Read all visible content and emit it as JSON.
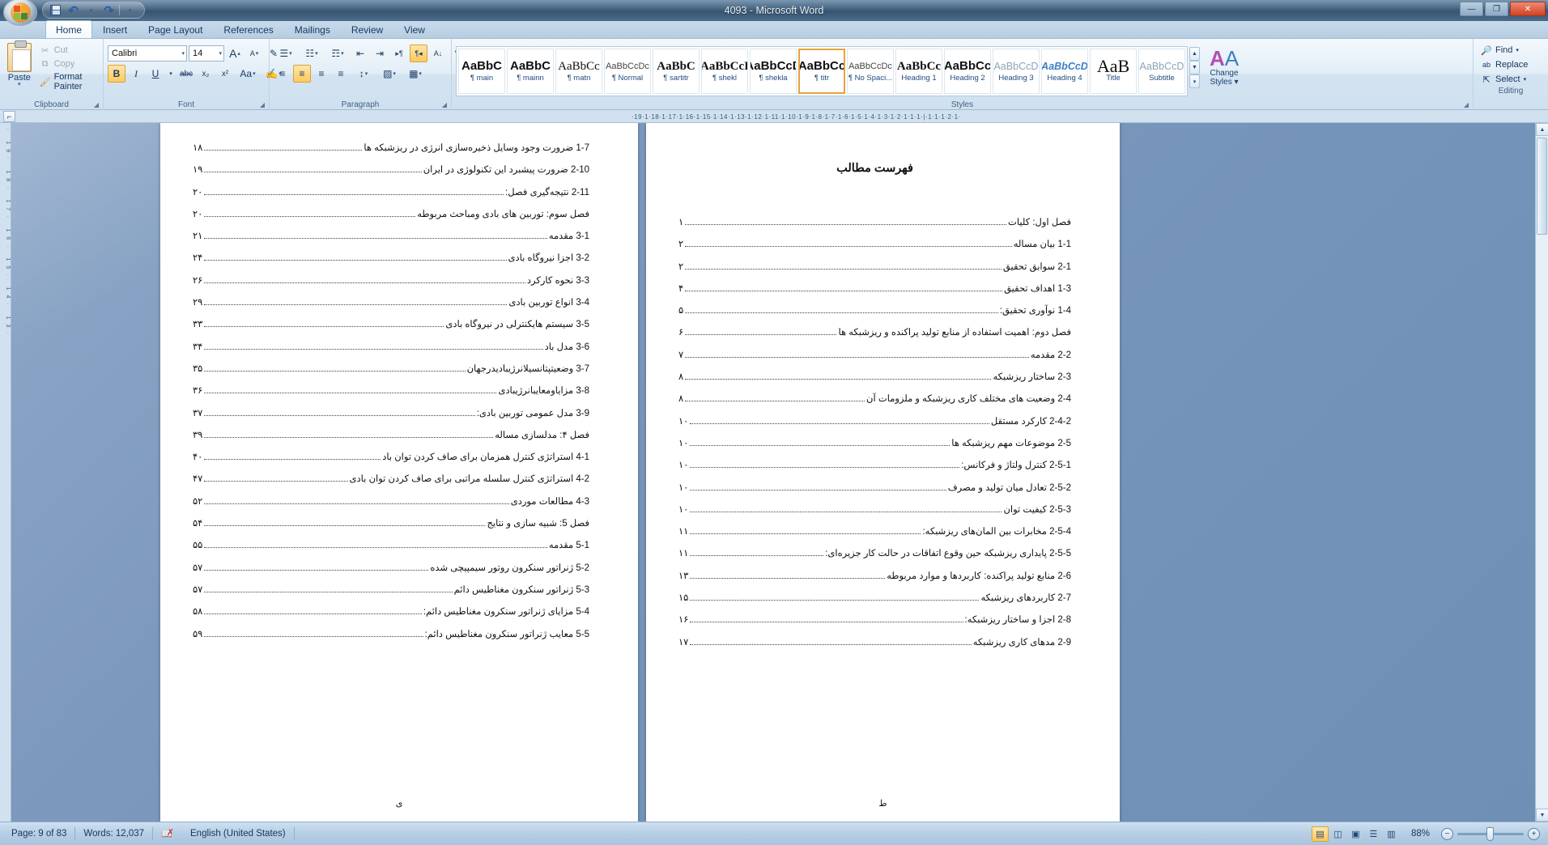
{
  "window": {
    "title": "4093 - Microsoft Word",
    "minimize": "—",
    "maximize": "❐",
    "close": "✕"
  },
  "quick_access": {
    "save": "save-icon",
    "undo": "↶",
    "undo_caret": "▾",
    "redo": "↷",
    "customize_caret": "▾"
  },
  "tabs": [
    {
      "label": "Home",
      "active": true
    },
    {
      "label": "Insert",
      "active": false
    },
    {
      "label": "Page Layout",
      "active": false
    },
    {
      "label": "References",
      "active": false
    },
    {
      "label": "Mailings",
      "active": false
    },
    {
      "label": "Review",
      "active": false
    },
    {
      "label": "View",
      "active": false
    }
  ],
  "ribbon": {
    "clipboard": {
      "label": "Clipboard",
      "paste": "Paste",
      "paste_caret": "▾",
      "cut": "Cut",
      "copy": "Copy",
      "format_painter": "Format Painter",
      "launcher": "◢"
    },
    "font": {
      "label": "Font",
      "font_name": "Calibri",
      "font_size": "14",
      "grow": "A",
      "shrink": "A",
      "clear_formatting": "✎",
      "bold": "B",
      "italic": "I",
      "underline": "U",
      "underline_caret": "▾",
      "strikethrough": "abc",
      "subscript": "x₂",
      "superscript": "x²",
      "change_case": "Aa",
      "change_case_caret": "▾",
      "highlight": "✍",
      "highlight_caret": "▾",
      "font_color": "A",
      "font_color_caret": "▾",
      "launcher": "◢"
    },
    "paragraph": {
      "label": "Paragraph",
      "bullets": "☰",
      "bullets_caret": "▾",
      "numbering": "☷",
      "numbering_caret": "▾",
      "multilevel": "☶",
      "multilevel_caret": "▾",
      "decrease_indent": "⇤",
      "increase_indent": "⇥",
      "ltr": "▸¶",
      "rtl": "¶◂",
      "sort": "A↓",
      "show_marks": "¶",
      "align_left": "≡",
      "align_center": "≡",
      "align_right": "≡",
      "justify": "≡",
      "line_spacing": "↕",
      "line_spacing_caret": "▾",
      "shading": "▨",
      "shading_caret": "▾",
      "borders": "▦",
      "borders_caret": "▾",
      "launcher": "◢"
    },
    "styles": {
      "label": "Styles",
      "items": [
        {
          "preview": "AaBbC",
          "name": "¶ main",
          "selected": false,
          "style": "bold-sans"
        },
        {
          "preview": "AaBbC",
          "name": "¶ mainn",
          "selected": false,
          "style": "bold-sans"
        },
        {
          "preview": "AaBbCс",
          "name": "¶ matn",
          "selected": false,
          "style": "serif"
        },
        {
          "preview": "AaBbCcDc",
          "name": "¶ Normal",
          "selected": false,
          "style": "small-sans"
        },
        {
          "preview": "AaBbC",
          "name": "¶ sartitr",
          "selected": false,
          "style": "bold-serif"
        },
        {
          "preview": "AaBbCcI",
          "name": "¶ shekl",
          "selected": false,
          "style": "bold-serif"
        },
        {
          "preview": "AaBbCcD",
          "name": "¶ shekla",
          "selected": false,
          "style": "bold-sans"
        },
        {
          "preview": "AaBbCc",
          "name": "¶ titr",
          "selected": true,
          "style": "bold-sans"
        },
        {
          "preview": "AaBbCcDc",
          "name": "¶ No Spaci...",
          "selected": false,
          "style": "small-sans"
        },
        {
          "preview": "AaBbCc",
          "name": "Heading 1",
          "selected": false,
          "style": "bold-serif"
        },
        {
          "preview": "AaBbCc",
          "name": "Heading 2",
          "selected": false,
          "style": "bold-sans"
        },
        {
          "preview": "AaBbCcD",
          "name": "Heading 3",
          "selected": false,
          "style": "light-sans"
        },
        {
          "preview": "AaBbCcD",
          "name": "Heading 4",
          "selected": false,
          "style": "italic-blue"
        },
        {
          "preview": "AaB",
          "name": "Title",
          "selected": false,
          "style": "big-serif"
        },
        {
          "preview": "AaBbCcD",
          "name": "Subtitle",
          "selected": false,
          "style": "light-sans"
        }
      ],
      "nav_up": "▲",
      "nav_down": "▼",
      "nav_more": "▾",
      "change_styles": "Change",
      "change_styles2": "Styles",
      "change_styles_caret": "▾",
      "launcher": "◢"
    },
    "editing": {
      "label": "Editing",
      "find": "Find",
      "find_caret": "▾",
      "replace": "Replace",
      "select": "Select",
      "select_caret": "▾"
    }
  },
  "ruler": {
    "tab_selector": "⌐",
    "marks": "·19·1·18·1·17·1·16·1·15·1·14·1·13·1·12·1·11·1·10·1·9·1·8·1·7·1·6·1·5·1·4·1·3·1·2·1·1·1·|·1·1·1·2·1·"
  },
  "document": {
    "left_page": {
      "footer": "ی",
      "entries": [
        {
          "text": "1-7 ضرورت وجود وسایل ذخیره‌سازی انرژی در ریزشبکه ها",
          "page": "۱۸"
        },
        {
          "text": "2-10 ضرورت پیشبرد این تکنولوژی در ایران",
          "page": "۱۹"
        },
        {
          "text": "2-11 نتیجه‌گیری فصل:",
          "page": "۲۰"
        },
        {
          "text": "فصل سوم: توربین های بادی ومباحث مربوطه",
          "page": "۲۰"
        },
        {
          "text": "3-1 مقدمه",
          "page": "۲۱"
        },
        {
          "text": "3-2 اجزا نیروگاه بادی",
          "page": "۲۴"
        },
        {
          "text": "3-3  نحوه کارکرد",
          "page": "۲۶"
        },
        {
          "text": "3-4 انواع توربین بادی",
          "page": "۲۹"
        },
        {
          "text": "3-5 سیستم هایکنترلی در نیروگاه بادی",
          "page": "۳۳"
        },
        {
          "text": "3-6 مدل باد",
          "page": "۳۴"
        },
        {
          "text": "3-7 وضعیتپتانسیلانرژیبادیدرجهان",
          "page": "۳۵"
        },
        {
          "text": "3-8 مزایاومعایبانرژیبادی",
          "page": "۳۶"
        },
        {
          "text": "3-9 مدل عمومی توربین بادی:",
          "page": "۳۷"
        },
        {
          "text": "فصل ۴: مدلسازی مساله",
          "page": "۳۹"
        },
        {
          "text": "4-1 استراتژی کنترل همزمان برای صاف کردن توان باد",
          "page": "۴۰"
        },
        {
          "text": "4-2 استراتژی کنترل سلسله مراتبی برای صاف کردن توان بادی",
          "page": "۴۷"
        },
        {
          "text": "4-3 مطالعات موردی",
          "page": "۵۲"
        },
        {
          "text": "فصل 5: شبیه سازی و نتایج",
          "page": "۵۴"
        },
        {
          "text": "5-1 مقدمه",
          "page": "۵۵"
        },
        {
          "text": "5-2 ژنراتور سنکرون روتور سیمپیچی شده",
          "page": "۵۷"
        },
        {
          "text": "5-3 ژنراتور سنکرون مغناطیس دائم",
          "page": "۵۷"
        },
        {
          "text": "5-4 مزایای ژنراتور سنکرون مغناطیس دائم:",
          "page": "۵۸"
        },
        {
          "text": "5-5 معایب ژنراتور سنکرون مغناطیس دائم:",
          "page": "۵۹"
        }
      ]
    },
    "right_page": {
      "title": "فهرست مطالب",
      "footer": "ط",
      "entries": [
        {
          "text": "فصل اول: کلیات",
          "page": "۱"
        },
        {
          "text": "1-1 بیان مساله",
          "page": "۲"
        },
        {
          "text": "2-1 سوابق تحقیق",
          "page": "۲"
        },
        {
          "text": "1-3 اهداف تحقیق",
          "page": "۴"
        },
        {
          "text": "1-4 نوآوری تحقیق:",
          "page": "۵"
        },
        {
          "text": "فصل دوم: اهمیت استفاده از منابع تولید پراکنده و ریزشبکه ها",
          "page": "۶"
        },
        {
          "text": "2-2  مقدمه",
          "page": "۷"
        },
        {
          "text": "2-3 ساختار ریزشبکه",
          "page": "۸"
        },
        {
          "text": "2-4 وضعیت های مختلف کاری ریزشبکه و ملزومات آن",
          "page": "۸"
        },
        {
          "text": "2-4-2 کارکرد مستقل",
          "page": "۱۰"
        },
        {
          "text": "2-5 موضوعات مهم ریزشبکه ها",
          "page": "۱۰"
        },
        {
          "text": "2-5-1 کنترل ولتاژ و فرکانس:",
          "page": "۱۰"
        },
        {
          "text": "2-5-2 تعادل میان تولید و مصرف",
          "page": "۱۰"
        },
        {
          "text": "2-5-3 کیفیت توان",
          "page": "۱۰"
        },
        {
          "text": "2-5-4 مخابرات بین المان‌های ریزشبکه:",
          "page": "۱۱"
        },
        {
          "text": "2-5-5 پایداری ریزشبکه حین وقوع اتفاقات در حالت کار جزیره‌ای:",
          "page": "۱۱"
        },
        {
          "text": "2-6  منابع تولید پراکنده: کاربردها و موارد مربوطه",
          "page": "۱۳"
        },
        {
          "text": "2-7 کاربردهای ریزشبکه",
          "page": "۱۵"
        },
        {
          "text": "2-8 اجزا و ساختار ریزشبکه:",
          "page": "۱۶"
        },
        {
          "text": "2-9 مدهای کاری ریزشبکه",
          "page": "۱۷"
        }
      ]
    },
    "scroll_up": "▲",
    "scroll_down": "▼"
  },
  "statusbar": {
    "page": "Page: 9 of 83",
    "words": "Words: 12,037",
    "proofing_icon": "spell-check-icon",
    "language": "English (United States)",
    "views": [
      {
        "name": "print-layout",
        "glyph": "▤",
        "active": true
      },
      {
        "name": "full-screen-reading",
        "glyph": "◫",
        "active": false
      },
      {
        "name": "web-layout",
        "glyph": "▣",
        "active": false
      },
      {
        "name": "outline",
        "glyph": "☰",
        "active": false
      },
      {
        "name": "draft",
        "glyph": "▥",
        "active": false
      }
    ],
    "zoom": "88%",
    "zoom_out": "−",
    "zoom_in": "+"
  }
}
